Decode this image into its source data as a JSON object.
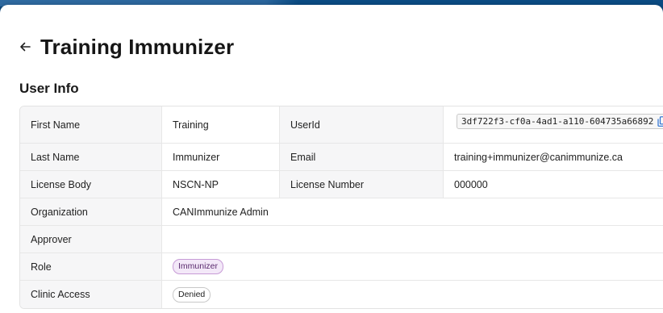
{
  "page": {
    "title": "Training Immunizer",
    "back_icon": "arrow-left-icon"
  },
  "user_info": {
    "section_title": "User Info",
    "first_name_label": "First Name",
    "first_name": "Training",
    "user_id_label": "UserId",
    "user_id": "3df722f3-cf0a-4ad1-a110-604735a66892",
    "copy_icon": "copy-icon",
    "last_name_label": "Last Name",
    "last_name": "Immunizer",
    "email_label": "Email",
    "email": "training+immunizer@canimmunize.ca",
    "license_body_label": "License Body",
    "license_body": "NSCN-NP",
    "license_number_label": "License Number",
    "license_number": "000000",
    "organization_label": "Organization",
    "organization": "CANImmunize Admin",
    "approver_label": "Approver",
    "approver": "",
    "role_label": "Role",
    "role": "Immunizer",
    "clinic_access_label": "Clinic Access",
    "clinic_access": "Denied"
  },
  "colors": {
    "top_bar": "#0b4b83",
    "role_tag_bg": "#f3e8f8",
    "role_tag_border": "#c79bd6"
  }
}
